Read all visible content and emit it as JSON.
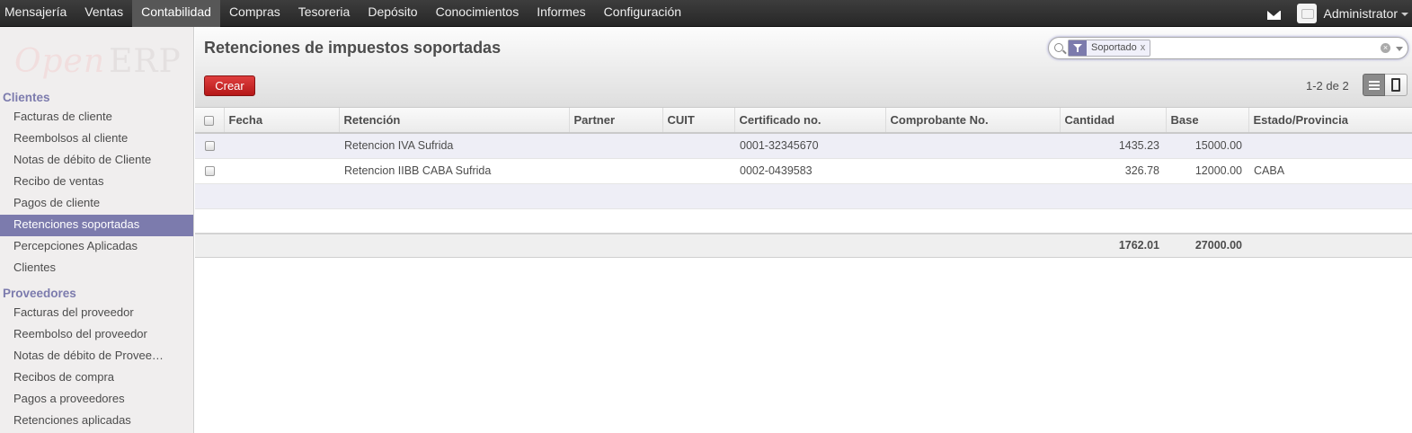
{
  "topnav": {
    "items": [
      {
        "label": "Mensajería",
        "active": false
      },
      {
        "label": "Ventas",
        "active": false
      },
      {
        "label": "Contabilidad",
        "active": true
      },
      {
        "label": "Compras",
        "active": false
      },
      {
        "label": "Tesoreria",
        "active": false
      },
      {
        "label": "Depósito",
        "active": false
      },
      {
        "label": "Conocimientos",
        "active": false
      },
      {
        "label": "Informes",
        "active": false
      },
      {
        "label": "Configuración",
        "active": false
      }
    ],
    "user": "Administrator"
  },
  "logo": {
    "part1": "Open",
    "part2": "ERP"
  },
  "sidebar": {
    "sections": [
      {
        "title": "Clientes",
        "items": [
          {
            "label": "Facturas de cliente",
            "active": false
          },
          {
            "label": "Reembolsos al cliente",
            "active": false
          },
          {
            "label": "Notas de débito de Cliente",
            "active": false
          },
          {
            "label": "Recibo de ventas",
            "active": false
          },
          {
            "label": "Pagos de cliente",
            "active": false
          },
          {
            "label": "Retenciones soportadas",
            "active": true
          },
          {
            "label": "Percepciones Aplicadas",
            "active": false
          },
          {
            "label": "Clientes",
            "active": false
          }
        ]
      },
      {
        "title": "Proveedores",
        "items": [
          {
            "label": "Facturas del proveedor",
            "active": false
          },
          {
            "label": "Reembolso del proveedor",
            "active": false
          },
          {
            "label": "Notas de débito de Provee…",
            "active": false
          },
          {
            "label": "Recibos de compra",
            "active": false
          },
          {
            "label": "Pagos a proveedores",
            "active": false
          },
          {
            "label": "Retenciones aplicadas",
            "active": false
          }
        ]
      }
    ]
  },
  "header": {
    "title": "Retenciones de impuestos soportadas",
    "search": {
      "facet_value": "Soportado",
      "facet_remove": "x",
      "clear": "×"
    },
    "create_label": "Crear",
    "pager": "1-2 de 2"
  },
  "table": {
    "columns": [
      "Fecha",
      "Retención",
      "Partner",
      "CUIT",
      "Certificado no.",
      "Comprobante No.",
      "Cantidad",
      "Base",
      "Estado/Provincia"
    ],
    "rows": [
      [
        "",
        "Retencion IVA Sufrida",
        "",
        "",
        "0001-32345670",
        "",
        "1435.23",
        "15000.00",
        ""
      ],
      [
        "",
        "Retencion IIBB CABA Sufrida",
        "",
        "",
        "0002-0439583",
        "",
        "326.78",
        "12000.00",
        "CABA"
      ]
    ],
    "totals": {
      "cantidad": "1762.01",
      "base": "27000.00"
    }
  }
}
